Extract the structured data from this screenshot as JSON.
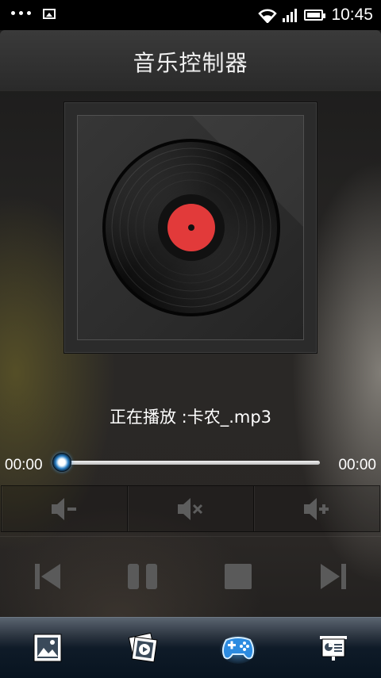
{
  "status_bar": {
    "time": "10:45",
    "icons": [
      "more-dots-icon",
      "image-notification-icon",
      "wifi-icon",
      "signal-icon",
      "battery-icon"
    ]
  },
  "header": {
    "title": "音乐控制器"
  },
  "album": {
    "art": "vinyl-record-icon",
    "label_color": "#e23a3a"
  },
  "now_playing": {
    "text": "正在播放 :卡农_.mp3"
  },
  "progress": {
    "current_time": "00:00",
    "total_time": "00:00",
    "fraction": 0.0,
    "accent_color": "#4aa6e8"
  },
  "volume_controls": [
    {
      "name": "volume-down",
      "icon": "volume-down-icon"
    },
    {
      "name": "mute",
      "icon": "mute-icon"
    },
    {
      "name": "volume-up",
      "icon": "volume-up-icon"
    }
  ],
  "transport_controls": [
    {
      "name": "previous",
      "icon": "skip-previous-icon"
    },
    {
      "name": "pause",
      "icon": "pause-icon"
    },
    {
      "name": "stop",
      "icon": "stop-icon"
    },
    {
      "name": "next",
      "icon": "skip-next-icon"
    }
  ],
  "bottom_nav": {
    "items": [
      {
        "name": "gallery",
        "icon": "image-icon",
        "selected": false
      },
      {
        "name": "video",
        "icon": "video-photos-icon",
        "selected": false
      },
      {
        "name": "games",
        "icon": "gamepad-icon",
        "selected": true
      },
      {
        "name": "presentation",
        "icon": "presentation-icon",
        "selected": false
      }
    ]
  }
}
